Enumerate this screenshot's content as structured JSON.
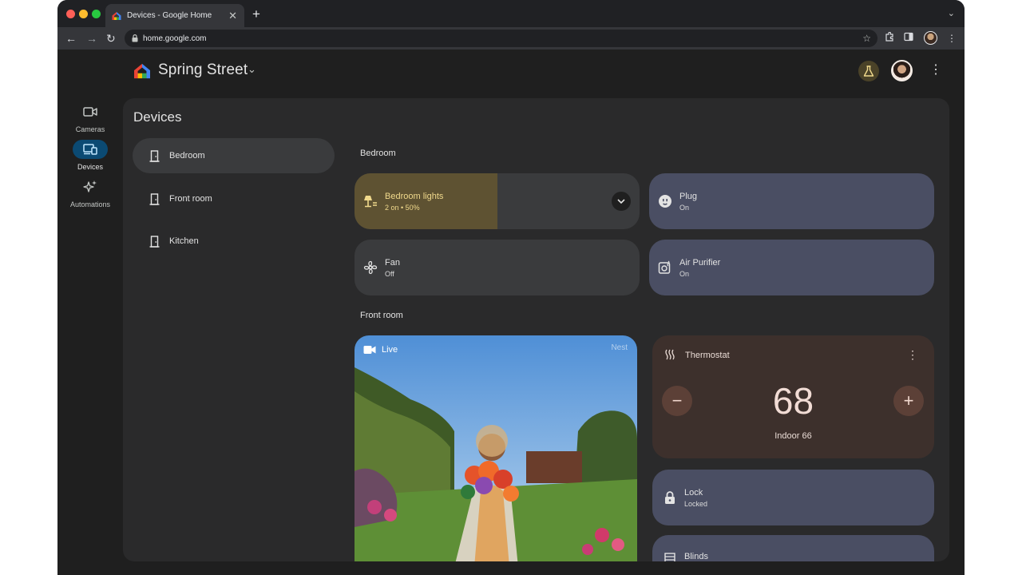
{
  "browser": {
    "tab_title": "Devices - Google Home",
    "url": "home.google.com",
    "tab_close": "✕",
    "new_tab": "+"
  },
  "header": {
    "home_name": "Spring Street"
  },
  "rail": {
    "items": [
      {
        "label": "Cameras",
        "icon": "camera-icon",
        "active": false
      },
      {
        "label": "Devices",
        "icon": "devices-icon",
        "active": true
      },
      {
        "label": "Automations",
        "icon": "sparkle-icon",
        "active": false
      }
    ]
  },
  "devices": {
    "title": "Devices",
    "rooms": [
      {
        "label": "Bedroom",
        "active": true
      },
      {
        "label": "Front room",
        "active": false
      },
      {
        "label": "Kitchen",
        "active": false
      }
    ],
    "sections": [
      {
        "heading": "Bedroom"
      },
      {
        "heading": "Front room"
      }
    ],
    "tiles": {
      "bedroom_lights": {
        "name": "Bedroom lights",
        "status": "2 on • 50%",
        "level": 0.5
      },
      "plug": {
        "name": "Plug",
        "status": "On"
      },
      "fan": {
        "name": "Fan",
        "status": "Off"
      },
      "air_purifier": {
        "name": "Air Purifier",
        "status": "On"
      },
      "lock": {
        "name": "Lock",
        "status": "Locked"
      },
      "blinds": {
        "name": "Blinds"
      }
    },
    "camera": {
      "live_label": "Live",
      "watermark": "Nest"
    },
    "thermostat": {
      "name": "Thermostat",
      "setpoint": "68",
      "indoor": "Indoor 66",
      "minus": "−",
      "plus": "+"
    }
  },
  "colors": {
    "accent_light": "#f0d98c",
    "rail_active": "#0b4a73",
    "thermostat_bg": "#3d302c",
    "tile_on": "#4a4e63"
  }
}
